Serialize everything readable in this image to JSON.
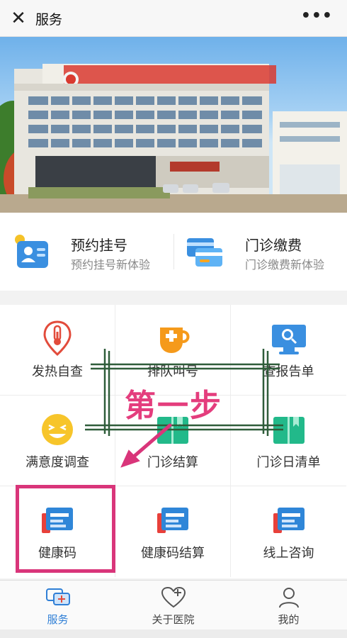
{
  "header": {
    "close_glyph": "✕",
    "title": "服务",
    "more_glyph": "•••"
  },
  "banner": {
    "slide_index": 1,
    "slide_count": 3
  },
  "quick": [
    {
      "title": "预约挂号",
      "subtitle": "预约挂号新体验",
      "icon": "appointment-card-icon"
    },
    {
      "title": "门诊缴费",
      "subtitle": "门诊缴费新体验",
      "icon": "payment-cards-icon"
    }
  ],
  "grid": [
    {
      "label": "发热自查",
      "icon": "thermometer-pin-icon"
    },
    {
      "label": "排队叫号",
      "icon": "cup-icon"
    },
    {
      "label": "查报告单",
      "icon": "monitor-search-icon"
    },
    {
      "label": "满意度调查",
      "icon": "smiley-icon"
    },
    {
      "label": "门诊结算",
      "icon": "book-icon"
    },
    {
      "label": "门诊日清单",
      "icon": "book-icon"
    },
    {
      "label": "健康码",
      "icon": "health-card-icon"
    },
    {
      "label": "健康码结算",
      "icon": "health-card-icon"
    },
    {
      "label": "线上咨询",
      "icon": "health-card-icon"
    }
  ],
  "annotation": {
    "step_text": "第一步",
    "color": "#d9357a"
  },
  "tabs": [
    {
      "label": "服务",
      "icon": "chat-plus-icon",
      "active": true
    },
    {
      "label": "关于医院",
      "icon": "heart-plus-icon",
      "active": false
    },
    {
      "label": "我的",
      "icon": "person-icon",
      "active": false
    }
  ],
  "colors": {
    "accent": "#2f7fd6",
    "orange": "#f59a1b",
    "red": "#e24b3b",
    "teal": "#22b98a"
  }
}
